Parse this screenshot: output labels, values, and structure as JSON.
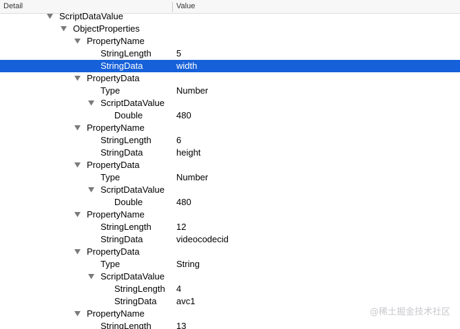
{
  "columns": {
    "detail": "Detail",
    "value": "Value"
  },
  "rows": [
    {
      "label": "ScriptDataValue",
      "value": "",
      "depth": 0,
      "expandable": true,
      "selected": false
    },
    {
      "label": "ObjectProperties",
      "value": "",
      "depth": 1,
      "expandable": true,
      "selected": false
    },
    {
      "label": "PropertyName",
      "value": "",
      "depth": 2,
      "expandable": true,
      "selected": false
    },
    {
      "label": "StringLength",
      "value": "5",
      "depth": 3,
      "expandable": false,
      "selected": false
    },
    {
      "label": "StringData",
      "value": "width",
      "depth": 3,
      "expandable": false,
      "selected": true
    },
    {
      "label": "PropertyData",
      "value": "",
      "depth": 2,
      "expandable": true,
      "selected": false
    },
    {
      "label": "Type",
      "value": "Number",
      "depth": 3,
      "expandable": false,
      "selected": false
    },
    {
      "label": "ScriptDataValue",
      "value": "",
      "depth": 3,
      "expandable": true,
      "selected": false
    },
    {
      "label": "Double",
      "value": "480",
      "depth": 4,
      "expandable": false,
      "selected": false
    },
    {
      "label": "PropertyName",
      "value": "",
      "depth": 2,
      "expandable": true,
      "selected": false
    },
    {
      "label": "StringLength",
      "value": "6",
      "depth": 3,
      "expandable": false,
      "selected": false
    },
    {
      "label": "StringData",
      "value": "height",
      "depth": 3,
      "expandable": false,
      "selected": false
    },
    {
      "label": "PropertyData",
      "value": "",
      "depth": 2,
      "expandable": true,
      "selected": false
    },
    {
      "label": "Type",
      "value": "Number",
      "depth": 3,
      "expandable": false,
      "selected": false
    },
    {
      "label": "ScriptDataValue",
      "value": "",
      "depth": 3,
      "expandable": true,
      "selected": false
    },
    {
      "label": "Double",
      "value": "480",
      "depth": 4,
      "expandable": false,
      "selected": false
    },
    {
      "label": "PropertyName",
      "value": "",
      "depth": 2,
      "expandable": true,
      "selected": false
    },
    {
      "label": "StringLength",
      "value": "12",
      "depth": 3,
      "expandable": false,
      "selected": false
    },
    {
      "label": "StringData",
      "value": "videocodecid",
      "depth": 3,
      "expandable": false,
      "selected": false
    },
    {
      "label": "PropertyData",
      "value": "",
      "depth": 2,
      "expandable": true,
      "selected": false
    },
    {
      "label": "Type",
      "value": "String",
      "depth": 3,
      "expandable": false,
      "selected": false
    },
    {
      "label": "ScriptDataValue",
      "value": "",
      "depth": 3,
      "expandable": true,
      "selected": false
    },
    {
      "label": "StringLength",
      "value": "4",
      "depth": 4,
      "expandable": false,
      "selected": false
    },
    {
      "label": "StringData",
      "value": "avc1",
      "depth": 4,
      "expandable": false,
      "selected": false
    },
    {
      "label": "PropertyName",
      "value": "",
      "depth": 2,
      "expandable": true,
      "selected": false
    },
    {
      "label": "StringLength",
      "value": "13",
      "depth": 3,
      "expandable": false,
      "selected": false
    }
  ],
  "watermark": "@稀土掘金技术社区",
  "colors": {
    "selection": "#1660d9",
    "header_bg": "#f7f7f7",
    "disclosure": "#7a7a7a"
  },
  "icons": {
    "disclosure": "disclosure-triangle-expanded-icon"
  }
}
